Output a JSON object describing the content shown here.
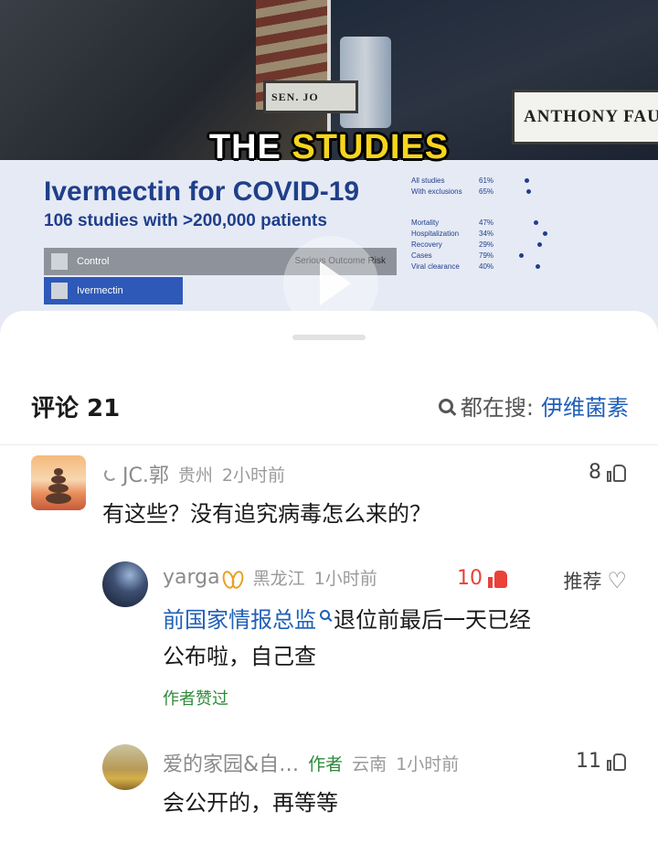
{
  "video": {
    "nameplate_left": "SEN. JO",
    "nameplate_right": "ANTHONY FAU",
    "caption_white": "THE ",
    "caption_yellow": "STUDIES",
    "slide_title": "Ivermectin for COVID-19",
    "slide_subtitle": "106 studies with >200,000 patients",
    "bar_control_label": "Control",
    "bar_control_right": "Serious Outcome Risk",
    "bar_ivermectin_label": "Ivermectin",
    "table_rows": [
      {
        "label": "All studies",
        "pct": "61%"
      },
      {
        "label": "With exclusions",
        "pct": "65%"
      },
      {
        "label": "Mortality",
        "pct": "47%"
      },
      {
        "label": "Hospitalization",
        "pct": "34%"
      },
      {
        "label": "Recovery",
        "pct": "29%"
      },
      {
        "label": "Cases",
        "pct": "79%"
      },
      {
        "label": "Viral clearance",
        "pct": "40%"
      }
    ]
  },
  "comments": {
    "title": "评论 21",
    "search_label": "都在搜:",
    "search_keyword": "伊维菌素",
    "items": [
      {
        "user": "JC.郭",
        "location": "贵州",
        "time": "2小时前",
        "likes": "8",
        "text": "有这些？没有追究病毒怎么来的？"
      },
      {
        "user": "yarga",
        "location": "黑龙江",
        "time": "1小时前",
        "likes": "10",
        "recommend": "推荐",
        "text_link": "前国家情报总监",
        "text_rest": "退位前最后一天已经",
        "text_line2": "公布啦，自己查",
        "author_liked": "作者赞过"
      },
      {
        "user": "爱的家园&自…",
        "tag": "作者",
        "location": "云南",
        "time": "1小时前",
        "likes": "11",
        "text": "会公开的，再等等"
      }
    ]
  }
}
